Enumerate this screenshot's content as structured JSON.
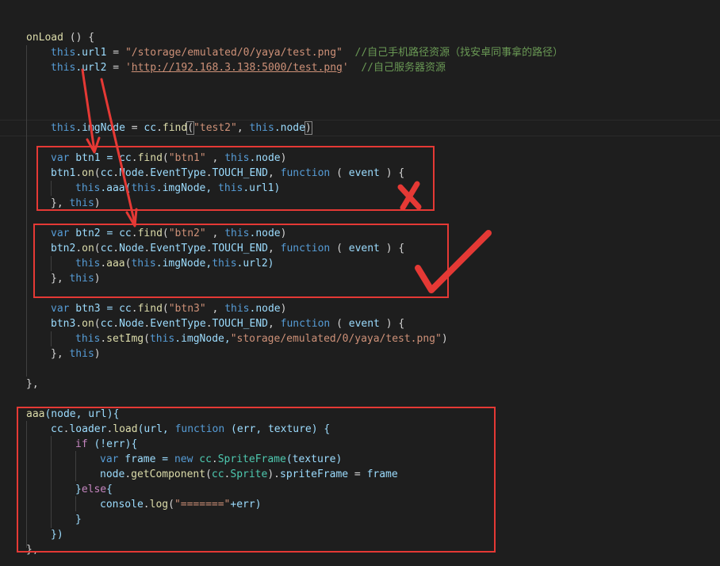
{
  "code": {
    "l1": [
      "onLoad",
      " () {"
    ],
    "l2": [
      "this",
      ".url1",
      " = ",
      "\"/storage/emulated/0/yaya/test.png\"",
      "  //自己手机路径资源（找安卓同事拿的路径）"
    ],
    "l3": [
      "this",
      ".url2",
      " = ",
      "'",
      "http://192.168.3.138:5000/test.png",
      "'",
      "  //自己服务器资源"
    ],
    "l4": [
      "this",
      ".imgNode",
      " = ",
      "cc",
      ".",
      "find",
      "(",
      "\"test2\"",
      ", ",
      "this",
      ".node",
      ")"
    ],
    "l5": [
      "var",
      " btn1 = ",
      "cc",
      ".",
      "find",
      "(",
      "\"btn1\"",
      " , ",
      "this",
      ".node",
      ")"
    ],
    "l6": [
      "btn1",
      ".",
      "on",
      "(",
      "cc",
      ".",
      "Node",
      ".",
      "EventType",
      ".",
      "TOUCH_END",
      ", ",
      "function",
      " ( ",
      "event",
      " ) {"
    ],
    "l7": [
      "this",
      ".aaa(",
      "this",
      ".imgNode, ",
      "this",
      ".url1)"
    ],
    "l8": [
      "}, ",
      "this",
      ")"
    ],
    "l9": [
      "var",
      " btn2 = ",
      "cc",
      ".",
      "find",
      "(",
      "\"btn2\"",
      " , ",
      "this",
      ".node",
      ")"
    ],
    "l10": [
      "btn2",
      ".",
      "on",
      "(",
      "cc",
      ".",
      "Node",
      ".",
      "EventType",
      ".",
      "TOUCH_END",
      ", ",
      "function",
      " ( ",
      "event",
      " ) {"
    ],
    "l11": [
      "this",
      ".",
      "aaa",
      "(",
      "this",
      ".imgNode,",
      "this",
      ".url2)"
    ],
    "l12": [
      "}, ",
      "this",
      ")"
    ],
    "l13": [
      "var",
      " btn3 = ",
      "cc",
      ".",
      "find",
      "(",
      "\"btn3\"",
      " , ",
      "this",
      ".node",
      ")"
    ],
    "l14": [
      "btn3",
      ".",
      "on",
      "(",
      "cc",
      ".",
      "Node",
      ".",
      "EventType",
      ".",
      "TOUCH_END",
      ", ",
      "function",
      " ( ",
      "event",
      " ) {"
    ],
    "l15": [
      "this",
      ".",
      "setImg",
      "(",
      "this",
      ".imgNode,",
      "\"storage/emulated/0/yaya/test.png\"",
      ")"
    ],
    "l16": [
      "}, ",
      "this",
      ")"
    ],
    "l17": [
      "},"
    ],
    "l18": [
      "aaa",
      "(node, url){"
    ],
    "l19": [
      "cc",
      ".",
      "loader",
      ".",
      "load",
      "(url, ",
      "function",
      " (err, texture) {"
    ],
    "l20": [
      "if",
      " (!err){"
    ],
    "l21": [
      "var",
      " frame = ",
      "new",
      " ",
      "cc",
      ".",
      "SpriteFrame",
      "(texture)"
    ],
    "l22": [
      "node",
      ".",
      "getComponent",
      "(",
      "cc",
      ".",
      "Sprite",
      ").",
      "spriteFrame",
      " = ",
      "frame"
    ],
    "l23": [
      "}",
      "else",
      "{"
    ],
    "l24": [
      "console",
      ".",
      "log",
      "(",
      "\"=======\"",
      "+err)"
    ],
    "l25": [
      "}"
    ],
    "l26": [
      "})"
    ],
    "l27": [
      "},"
    ]
  },
  "colors": {
    "annotation_red": "#e53935",
    "background": "#1e1e1e"
  }
}
